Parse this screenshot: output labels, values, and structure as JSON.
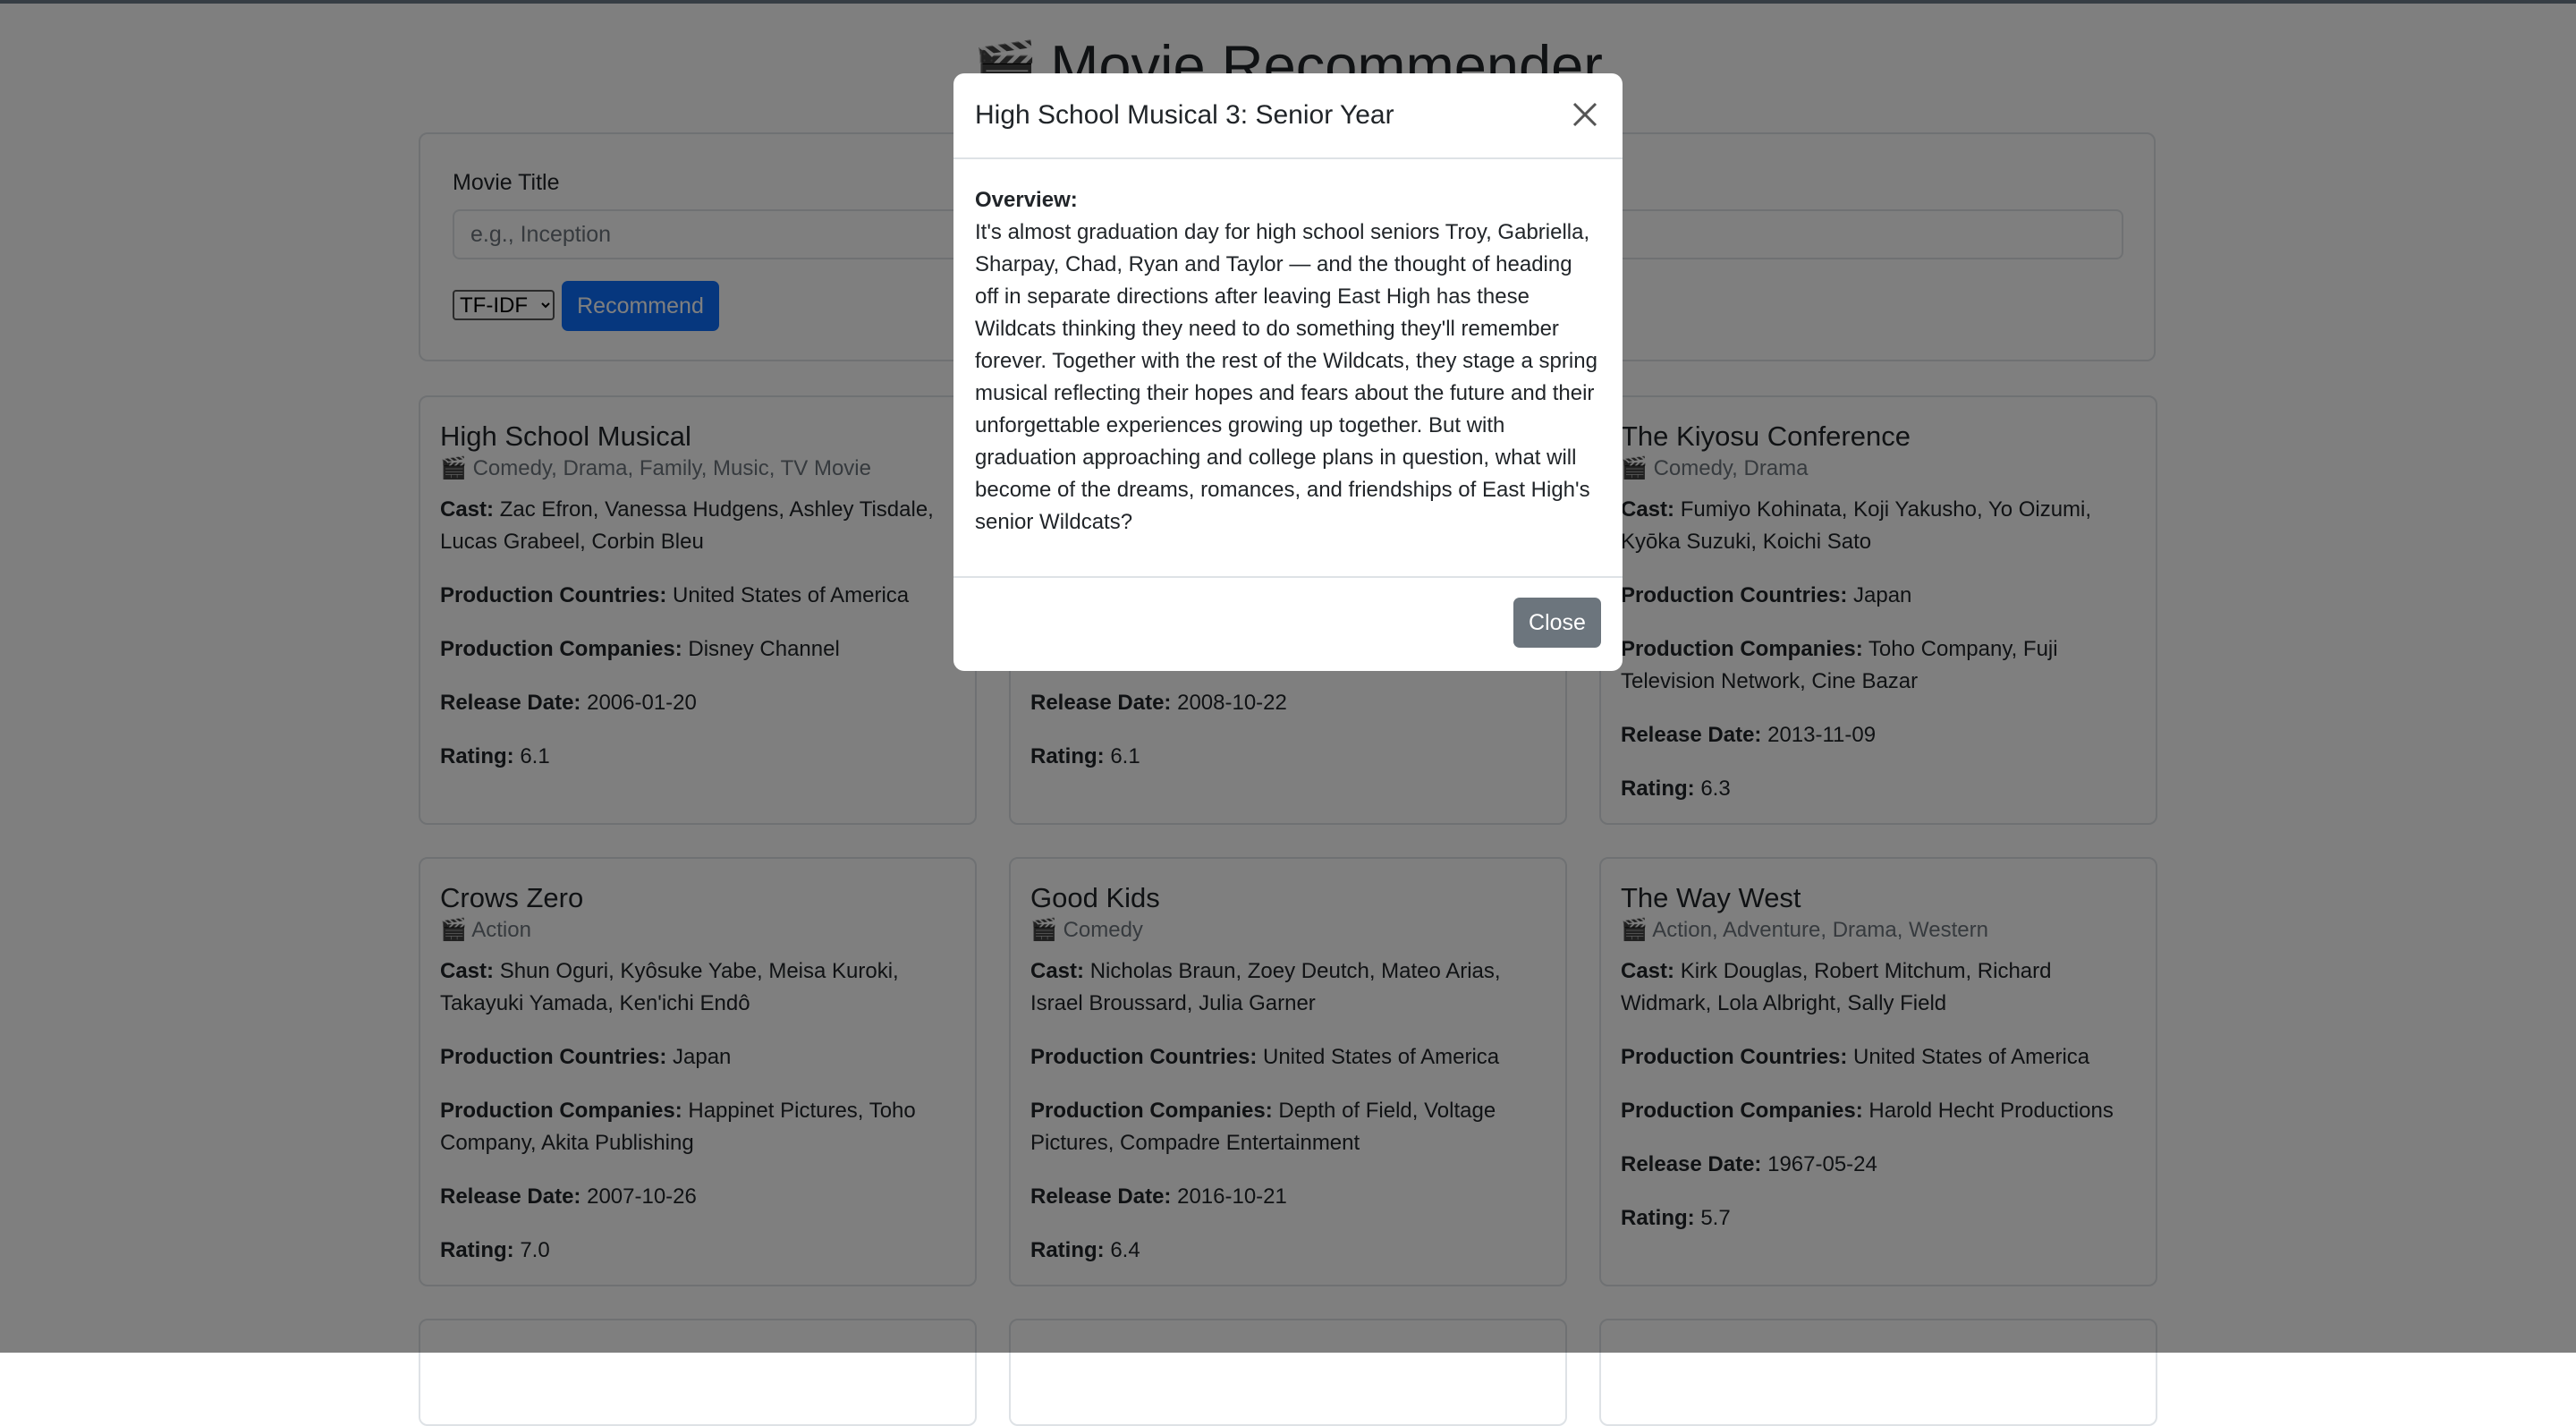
{
  "header": {
    "icon": "clapperboard-icon",
    "title": "Movie Recommender"
  },
  "form": {
    "label": "Movie Title",
    "placeholder": "e.g., Inception",
    "method": "TF-IDF",
    "recommend_label": "Recommend"
  },
  "labels": {
    "cast": "Cast:",
    "countries": "Production Countries:",
    "companies": "Production Companies:",
    "release": "Release Date:",
    "rating": "Rating:"
  },
  "cards": [
    {
      "title": "High School Musical",
      "genres": "Comedy, Drama, Family, Music, TV Movie",
      "cast": "Zac Efron, Vanessa Hudgens, Ashley Tisdale, Lucas Grabeel, Corbin Bleu",
      "countries": "United States of America",
      "companies": "Disney Channel",
      "release": "2006-01-20",
      "rating": "6.1"
    },
    {
      "title": "",
      "genres": "",
      "cast": "",
      "countries": "",
      "companies": "",
      "release": "2008-10-22",
      "rating": "6.1"
    },
    {
      "title": "The Kiyosu Conference",
      "genres": "Comedy, Drama",
      "cast": "Fumiyo Kohinata, Koji Yakusho, Yo Oizumi, Kyōka Suzuki, Koichi Sato",
      "countries": "Japan",
      "companies": "Toho Company, Fuji Television Network, Cine Bazar",
      "release": "2013-11-09",
      "rating": "6.3"
    },
    {
      "title": "Crows Zero",
      "genres": "Action",
      "cast": "Shun Oguri, Kyôsuke Yabe, Meisa Kuroki, Takayuki Yamada, Ken'ichi Endô",
      "countries": "Japan",
      "companies": "Happinet Pictures, Toho Company, Akita Publishing",
      "release": "2007-10-26",
      "rating": "7.0"
    },
    {
      "title": "Good Kids",
      "genres": "Comedy",
      "cast": "Nicholas Braun, Zoey Deutch, Mateo Arias, Israel Broussard, Julia Garner",
      "countries": "United States of America",
      "companies": "Depth of Field, Voltage Pictures, Compadre Entertainment",
      "release": "2016-10-21",
      "rating": "6.4"
    },
    {
      "title": "The Way West",
      "genres": "Action, Adventure, Drama, Western",
      "cast": "Kirk Douglas, Robert Mitchum, Richard Widmark, Lola Albright, Sally Field",
      "countries": "United States of America",
      "companies": "Harold Hecht Productions",
      "release": "1967-05-24",
      "rating": "5.7"
    }
  ],
  "modal": {
    "title": "High School Musical 3: Senior Year",
    "overview_label": "Overview:",
    "overview": "It's almost graduation day for high school seniors Troy, Gabriella, Sharpay, Chad, Ryan and Taylor — and the thought of heading off in separate directions after leaving East High has these Wildcats thinking they need to do something they'll remember forever. Together with the rest of the Wildcats, they stage a spring musical reflecting their hopes and fears about the future and their unforgettable experiences growing up together. But with graduation approaching and college plans in question, what will become of the dreams, romances, and friendships of East High's senior Wildcats?",
    "close_label": "Close"
  }
}
